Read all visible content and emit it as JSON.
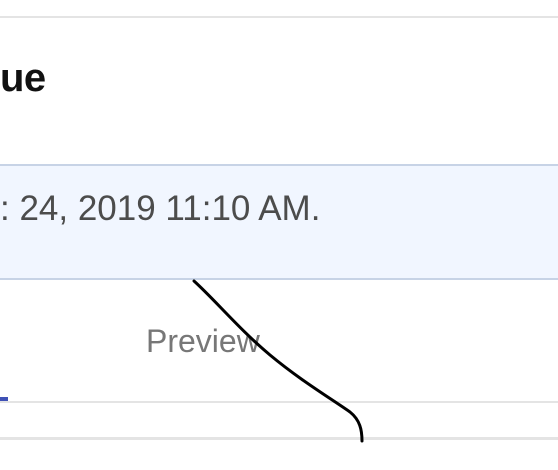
{
  "header": {
    "title": "ue"
  },
  "banner": {
    "text": ": 24, 2019 11:10 AM."
  },
  "tabs": [
    {
      "label": "Preview",
      "active": false
    }
  ],
  "colors": {
    "banner_background": "#f1f6ff",
    "banner_border": "#c7d3e6",
    "tab_active_indicator": "#3f51b5",
    "divider": "#e4e4e4"
  }
}
